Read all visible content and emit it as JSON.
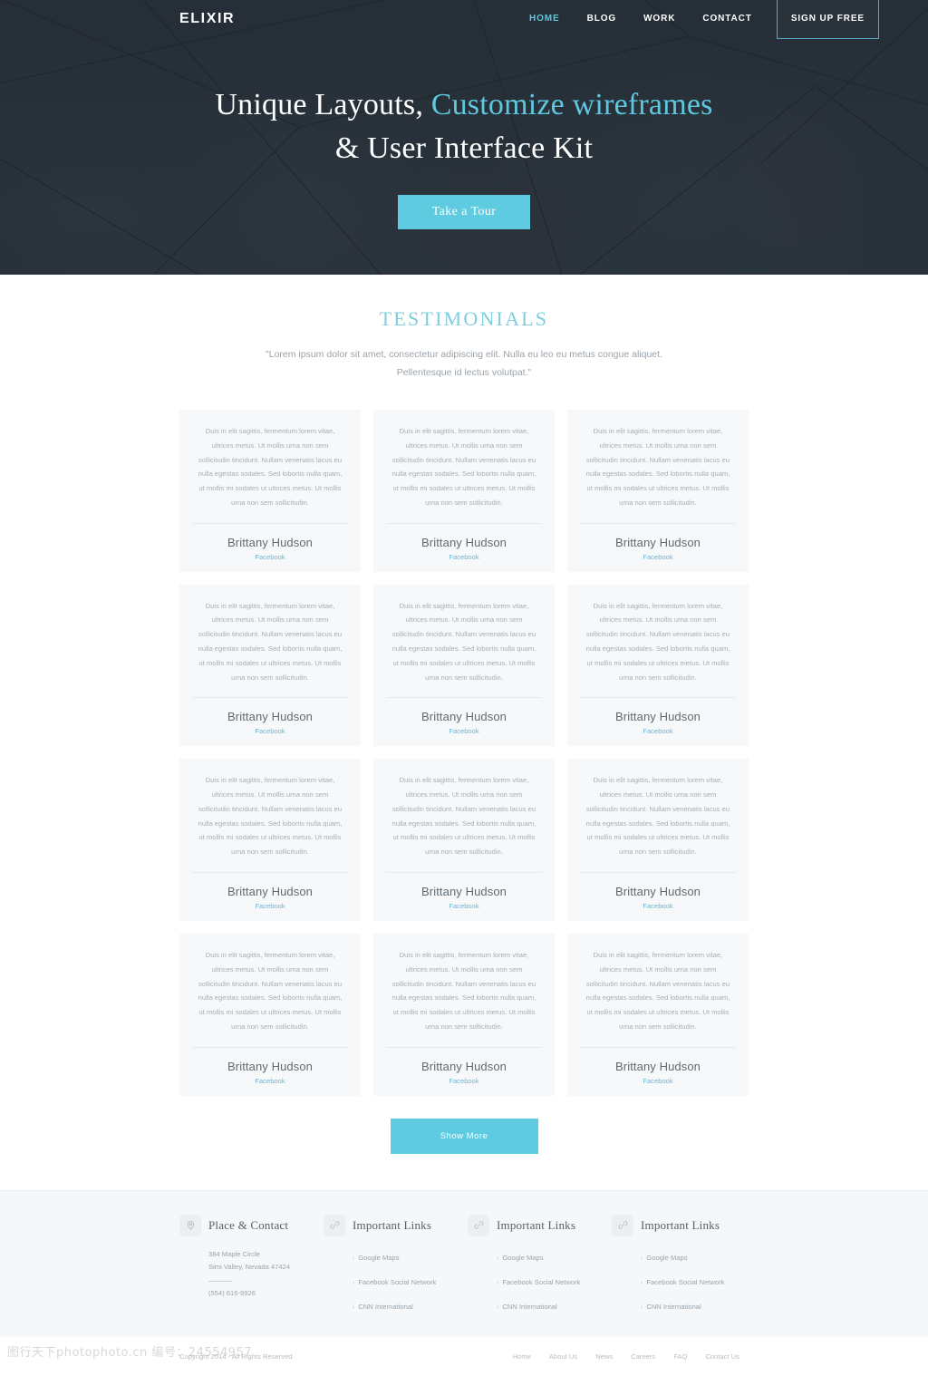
{
  "header": {
    "brand": "ELIXIR",
    "nav": [
      {
        "label": "HOME",
        "active": true
      },
      {
        "label": "BLOG",
        "active": false
      },
      {
        "label": "WORK",
        "active": false
      },
      {
        "label": "CONTACT",
        "active": false
      }
    ],
    "signup_label": "SIGN UP FREE"
  },
  "hero": {
    "title_part1": "Unique Layouts, ",
    "title_accent": "Customize wireframes",
    "title_part2": "& User Interface Kit",
    "cta_label": "Take a Tour"
  },
  "testimonials": {
    "heading": "TESTIMONIALS",
    "subtitle": "\"Lorem ipsum dolor sit amet, consectetur adipiscing elit. Nulla eu leo eu metus congue aliquet. Pellentesque id lectus volutpat.\"",
    "card_body": "Duis in elit sagittis, fermentum lorem vitae, ultrices metus. Ut mollis urna non sem sollicitudin tincidunt. Nullam venenatis lacus eu nulla egestas sodales. Sed lobortis nulla quam, ut mollis mi sodales ut ultrices metus. Ut mollis urna non sem sollicitudin.",
    "card_name": "Brittany Hudson",
    "card_link": "Facebook",
    "card_count": 12,
    "show_more_label": "Show More"
  },
  "footer": {
    "columns": [
      {
        "icon": "location-pin-icon",
        "title": "Place & Contact",
        "type": "contact",
        "address_line1": "384 Maple Circle",
        "address_line2": "Simi Valley, Nevada 47424",
        "phone": "(554) 616-9926"
      },
      {
        "icon": "link-icon",
        "title": "Important Links",
        "type": "links",
        "links": [
          "Google Maps",
          "Facebook Social Network",
          "CNN International"
        ]
      },
      {
        "icon": "link-icon",
        "title": "Important Links",
        "type": "links",
        "links": [
          "Google Maps",
          "Facebook Social Network",
          "CNN International"
        ]
      },
      {
        "icon": "link-icon",
        "title": "Important Links",
        "type": "links",
        "links": [
          "Google Maps",
          "Facebook Social Network",
          "CNN International"
        ]
      }
    ],
    "copyright": "Copyright 2014 - All Rights Reserved",
    "nav": [
      "Home",
      "About Us",
      "News",
      "Careers",
      "FAQ",
      "Contact Us"
    ],
    "watermark": "图行天下photophoto.cn  编号：24554957"
  },
  "colors": {
    "accent": "#5fcbe0",
    "heading": "#7fcede",
    "hero_bg": "#2b343d",
    "card_bg": "#f7f8f9",
    "footer_bg": "#f5f7f8"
  }
}
